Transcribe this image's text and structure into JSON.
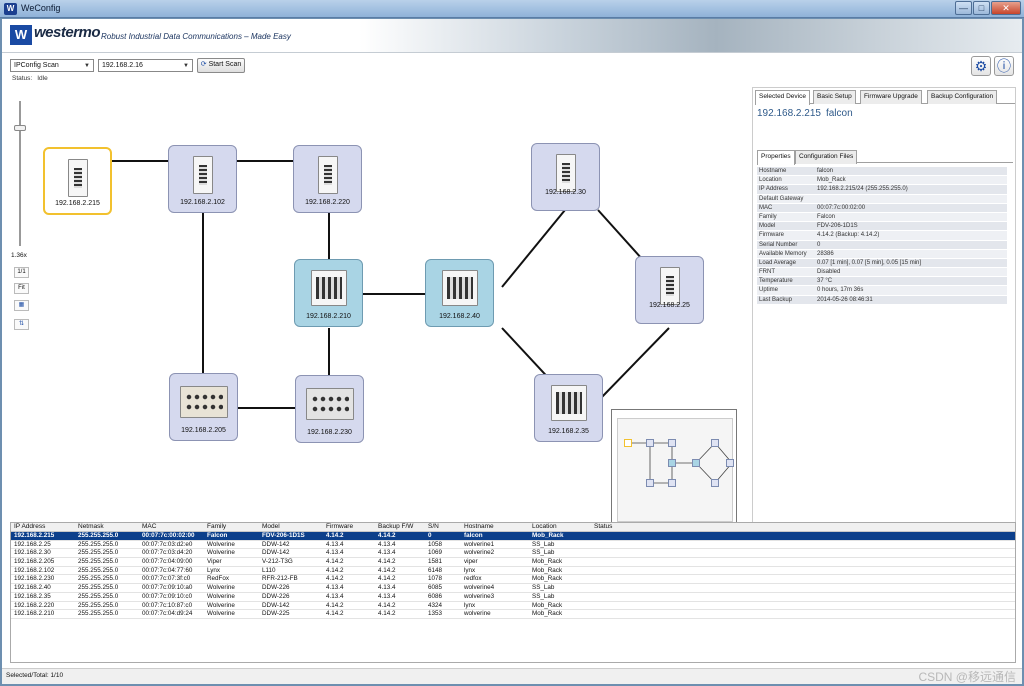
{
  "window": {
    "app_icon": "W",
    "title": "WeConfig",
    "min": "—",
    "max": "□",
    "close": "✕"
  },
  "banner": {
    "logo_mark": "W",
    "logo_word": "westermo",
    "tagline": "Robust Industrial Data Communications – Made Easy"
  },
  "toolbar": {
    "scan_mode": "IPConfig Scan",
    "ip_select": "192.168.2.16",
    "start_scan": "Start Scan",
    "status_label": "Status:",
    "status_value": "Idle",
    "settings_icon": "gear-icon",
    "info_icon": "info-icon"
  },
  "zoom": {
    "level": "1.36x",
    "one_to_one": "1/1",
    "fit": "Fit"
  },
  "topology": {
    "devices": [
      {
        "ip": "192.168.2.215",
        "state": "selected"
      },
      {
        "ip": "192.168.2.102",
        "state": "normal"
      },
      {
        "ip": "192.168.2.220",
        "state": "normal"
      },
      {
        "ip": "192.168.2.210",
        "state": "highlighted"
      },
      {
        "ip": "192.168.2.40",
        "state": "highlighted"
      },
      {
        "ip": "192.168.2.30",
        "state": "normal"
      },
      {
        "ip": "192.168.2.25",
        "state": "normal"
      },
      {
        "ip": "192.168.2.35",
        "state": "normal"
      },
      {
        "ip": "192.168.2.205",
        "state": "normal"
      },
      {
        "ip": "192.168.2.230",
        "state": "normal"
      }
    ]
  },
  "panel": {
    "tabs": [
      "Selected Device",
      "Basic Setup",
      "Firmware Upgrade",
      "Backup Configuration"
    ],
    "header_ip": "192.168.2.215",
    "header_name": "falcon",
    "subtabs": [
      "Properties",
      "Configuration Files"
    ],
    "properties": [
      {
        "k": "Hostname",
        "v": "falcon"
      },
      {
        "k": "Location",
        "v": "Mob_Rack"
      },
      {
        "k": "IP Address",
        "v": "192.168.2.215/24  (255.255.255.0)"
      },
      {
        "k": "Default Gateway",
        "v": ""
      },
      {
        "k": "MAC",
        "v": "00:07:7c:00:02:00"
      },
      {
        "k": "Family",
        "v": "Falcon"
      },
      {
        "k": "Model",
        "v": "FDV-206-1D1S"
      },
      {
        "k": "Firmware",
        "v": "4.14.2 (Backup: 4.14.2)"
      },
      {
        "k": "Serial Number",
        "v": "0"
      },
      {
        "k": "Available Memory",
        "v": "28386"
      },
      {
        "k": "Load Average",
        "v": "0.07 [1 min],  0.07 [5 min],  0.05 [15 min]"
      },
      {
        "k": "FRNT",
        "v": "Disabled"
      },
      {
        "k": "Temperature",
        "v": "37 °C"
      },
      {
        "k": "Uptime",
        "v": "0 hours, 17m 36s"
      },
      {
        "k": "Last Backup",
        "v": "2014-05-26 08:46:31"
      }
    ]
  },
  "table": {
    "columns": [
      "IP Address",
      "Netmask",
      "MAC",
      "Family",
      "Model",
      "Firmware",
      "Backup F/W",
      "S/N",
      "Hostname",
      "Location",
      "Status"
    ],
    "rows": [
      [
        "192.168.2.215",
        "255.255.255.0",
        "00:07:7c:00:02:00",
        "Falcon",
        "FDV-206-1D1S",
        "4.14.2",
        "4.14.2",
        "0",
        "falcon",
        "Mob_Rack",
        ""
      ],
      [
        "192.168.2.25",
        "255.255.255.0",
        "00:07:7c:03:d2:e0",
        "Wolverine",
        "DDW-142",
        "4.13.4",
        "4.13.4",
        "1058",
        "wolverine1",
        "SS_Lab",
        ""
      ],
      [
        "192.168.2.30",
        "255.255.255.0",
        "00:07:7c:03:d4:20",
        "Wolverine",
        "DDW-142",
        "4.13.4",
        "4.13.4",
        "1069",
        "wolverine2",
        "SS_Lab",
        ""
      ],
      [
        "192.168.2.205",
        "255.255.255.0",
        "00:07:7c:04:09:00",
        "Viper",
        "V-212-T3G",
        "4.14.2",
        "4.14.2",
        "1581",
        "viper",
        "Mob_Rack",
        ""
      ],
      [
        "192.168.2.102",
        "255.255.255.0",
        "00:07:7c:04:77:60",
        "Lynx",
        "L110",
        "4.14.2",
        "4.14.2",
        "6148",
        "lynx",
        "Mob_Rack",
        ""
      ],
      [
        "192.168.2.230",
        "255.255.255.0",
        "00:07:7c:07:3f:c0",
        "RedFox",
        "RFR-212-FB",
        "4.14.2",
        "4.14.2",
        "1078",
        "redfox",
        "Mob_Rack",
        ""
      ],
      [
        "192.168.2.40",
        "255.255.255.0",
        "00:07:7c:09:10:a0",
        "Wolverine",
        "DDW-226",
        "4.13.4",
        "4.13.4",
        "6085",
        "wolverine4",
        "SS_Lab",
        ""
      ],
      [
        "192.168.2.35",
        "255.255.255.0",
        "00:07:7c:09:10:c0",
        "Wolverine",
        "DDW-226",
        "4.13.4",
        "4.13.4",
        "6086",
        "wolverine3",
        "SS_Lab",
        ""
      ],
      [
        "192.168.2.220",
        "255.255.255.0",
        "00:07:7c:10:87:c0",
        "Wolverine",
        "DDW-142",
        "4.14.2",
        "4.14.2",
        "4324",
        "lynx",
        "Mob_Rack",
        ""
      ],
      [
        "192.168.2.210",
        "255.255.255.0",
        "00:07:7c:04:d9:24",
        "Wolverine",
        "DDW-225",
        "4.14.2",
        "4.14.2",
        "1353",
        "wolverine",
        "Mob_Rack",
        ""
      ]
    ],
    "selected_index": 0
  },
  "statusbar": {
    "text": "Selected/Total: 1/10",
    "watermark": "CSDN @移远通信"
  },
  "colors": {
    "accent": "#0c3f8b",
    "selected_border": "#f2c12e",
    "node_fill": "#d5d9ee",
    "node_highlight": "#a9d4e4"
  }
}
